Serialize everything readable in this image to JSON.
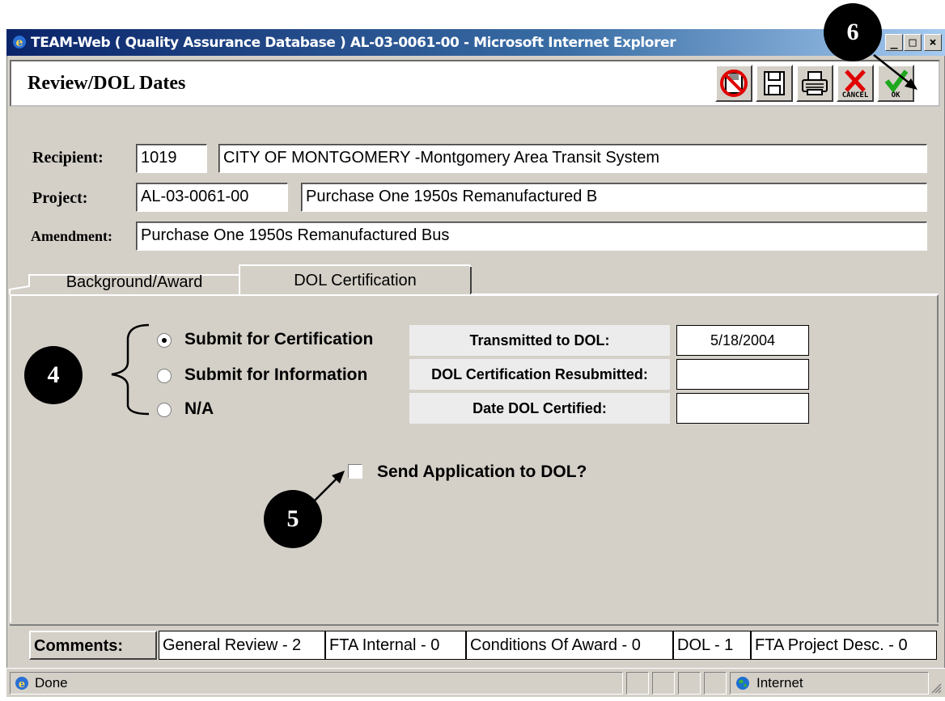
{
  "window": {
    "title": "TEAM-Web ( Quality Assurance Database ) AL-03-0061-00 - Microsoft Internet Explorer",
    "minimize": "_",
    "maximize": "□",
    "close": "×"
  },
  "header": {
    "title": "Review/DOL Dates",
    "toolbar": {
      "cancel_label": "CANCEL",
      "ok_label": "OK"
    }
  },
  "form": {
    "recipient_label": "Recipient:",
    "recipient_id": "1019",
    "recipient_name": "CITY OF MONTGOMERY -Montgomery Area Transit System",
    "project_label": "Project:",
    "project_id": "AL-03-0061-00",
    "project_name": "Purchase One 1950s Remanufactured B",
    "amendment_label": "Amendment:",
    "amendment_value": "Purchase One 1950s Remanufactured Bus"
  },
  "tabs": [
    {
      "label": "Background/Award",
      "active": false
    },
    {
      "label": "DOL Certification",
      "active": true
    }
  ],
  "dol": {
    "options": [
      {
        "label": "Submit for Certification",
        "selected": true
      },
      {
        "label": "Submit for Information",
        "selected": false
      },
      {
        "label": "N/A",
        "selected": false
      }
    ],
    "dates": [
      {
        "label": "Transmitted to DOL:",
        "value": "5/18/2004"
      },
      {
        "label": "DOL Certification Resubmitted:",
        "value": ""
      },
      {
        "label": "Date DOL Certified:",
        "value": ""
      }
    ],
    "send_label": "Send Application to DOL?",
    "send_checked": false
  },
  "callouts": {
    "c4": "4",
    "c5": "5",
    "c6": "6"
  },
  "comments": {
    "label": "Comments:",
    "items": [
      "General Review - 2",
      "FTA Internal - 0",
      "Conditions Of Award - 0",
      "DOL - 1",
      "FTA Project Desc. - 0"
    ]
  },
  "status": {
    "text": "Done",
    "zone": "Internet"
  },
  "colors": {
    "title_start": "#0a246a",
    "title_end": "#a6caf0",
    "chrome": "#d4d0c8"
  }
}
